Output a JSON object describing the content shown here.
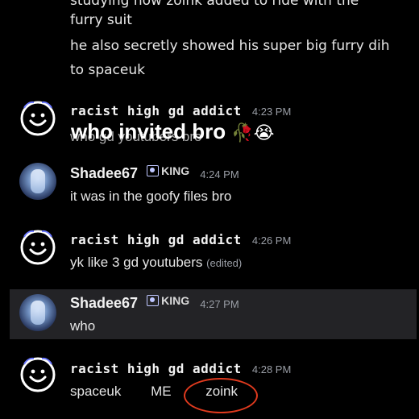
{
  "top_text": {
    "line0": "studying how zoink added to ride with the",
    "line1": "furry suit",
    "line2": "he also secretly showed his super big furry dih",
    "line3": "to spaceuk"
  },
  "messages": [
    {
      "author": "racist high gd addict",
      "time": "4:23 PM",
      "overlay_caption": "who invited bro",
      "overlay_emojis": "🥀😭",
      "body_hidden": "who gd youtubers bro"
    },
    {
      "author": "Shadee67",
      "badge": "KING",
      "time": "4:24 PM",
      "body": "it was in the goofy files bro"
    },
    {
      "author": "racist high gd addict",
      "time": "4:26 PM",
      "body": "yk like 3 gd youtubers",
      "edited": "(edited)"
    },
    {
      "author": "Shadee67",
      "badge": "KING",
      "time": "4:27 PM",
      "body": "who"
    },
    {
      "author": "racist high gd addict",
      "time": "4:28 PM",
      "words": [
        "spaceuk",
        "ME",
        "zoink"
      ]
    }
  ],
  "colors": {
    "background": "#000000",
    "highlight_row": "#232326",
    "circle": "#e03a1e"
  }
}
